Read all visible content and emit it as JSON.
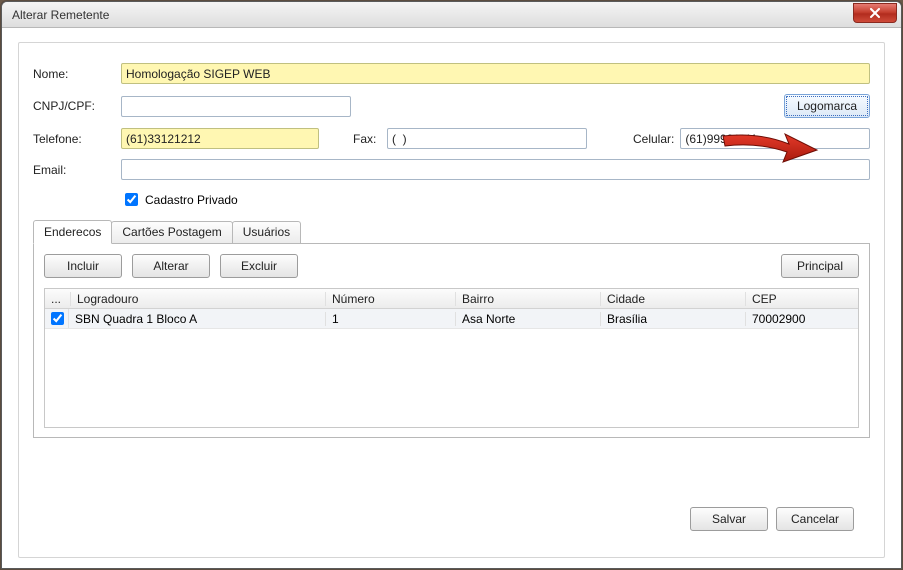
{
  "window": {
    "title": "Alterar Remetente"
  },
  "form": {
    "nome_label": "Nome:",
    "nome_value": "Homologação SIGEP WEB",
    "cnpj_label": "CNPJ/CPF:",
    "cnpj_value": "",
    "telefone_label": "Telefone:",
    "telefone_value": "(61)33121212",
    "fax_label": "Fax:",
    "fax_value": "(  )",
    "celular_label": "Celular:",
    "celular_value": "(61)99991111",
    "email_label": "Email:",
    "email_value": "",
    "cadastro_privado_label": "Cadastro Privado",
    "logomarca_label": "Logomarca"
  },
  "tabs": {
    "enderecos": "Enderecos",
    "cartoes": "Cartões Postagem",
    "usuarios": "Usuários"
  },
  "toolbar": {
    "incluir": "Incluir",
    "alterar": "Alterar",
    "excluir": "Excluir",
    "principal": "Principal"
  },
  "table": {
    "headers": {
      "ellipsis": "...",
      "logradouro": "Logradouro",
      "numero": "Número",
      "bairro": "Bairro",
      "cidade": "Cidade",
      "cep": "CEP"
    },
    "rows": [
      {
        "checked": true,
        "logradouro": "SBN Quadra 1 Bloco A",
        "numero": "1",
        "bairro": "Asa Norte",
        "cidade": "Brasília",
        "cep": "70002900"
      }
    ]
  },
  "footer": {
    "salvar": "Salvar",
    "cancelar": "Cancelar"
  }
}
